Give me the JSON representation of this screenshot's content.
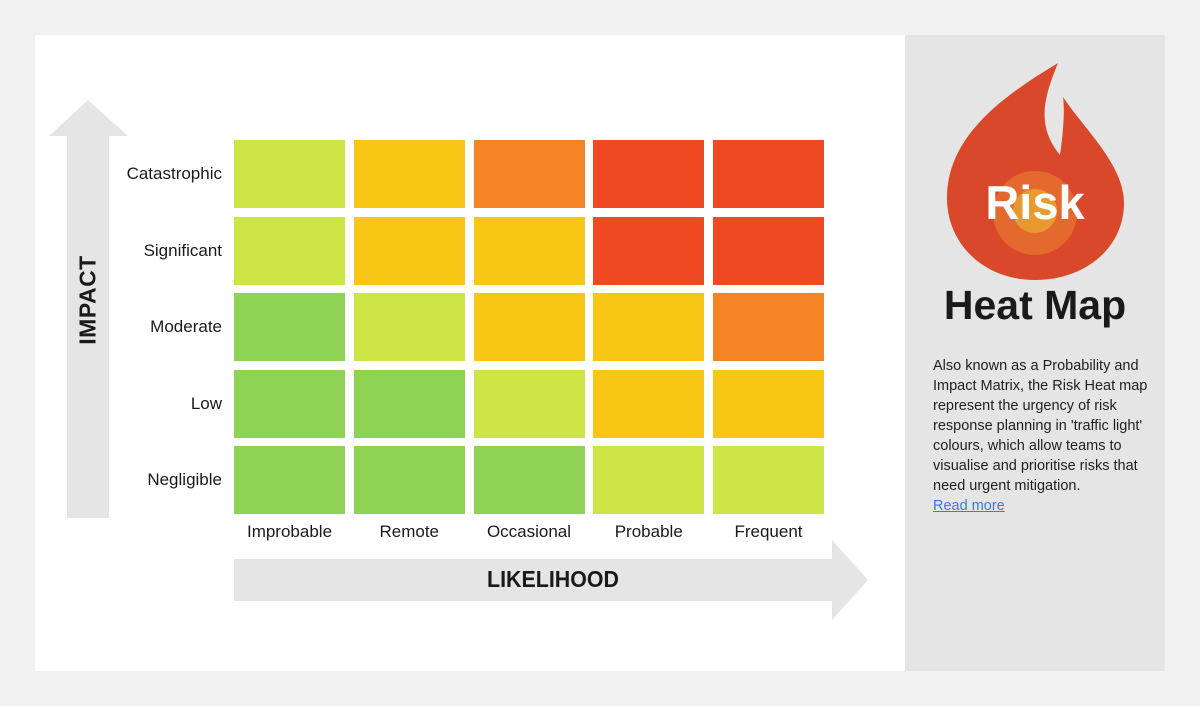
{
  "chart_data": {
    "type": "heatmap",
    "title": "Risk Heat Map",
    "xlabel": "LIKELIHOOD",
    "ylabel": "IMPACT",
    "x_categories": [
      "Improbable",
      "Remote",
      "Occasional",
      "Probable",
      "Frequent"
    ],
    "y_categories": [
      "Catastrophic",
      "Significant",
      "Moderate",
      "Low",
      "Negligible"
    ],
    "levels": {
      "green": "#8ed354",
      "yellow-green": "#cde646",
      "amber": "#f8c614",
      "orange": "#f48425",
      "red": "#f04a25"
    },
    "cells": [
      [
        "yellow-green",
        "amber",
        "orange",
        "red",
        "red"
      ],
      [
        "yellow-green",
        "amber",
        "amber",
        "red",
        "red"
      ],
      [
        "green",
        "yellow-green",
        "amber",
        "amber",
        "orange"
      ],
      [
        "green",
        "green",
        "yellow-green",
        "amber",
        "amber"
      ],
      [
        "green",
        "green",
        "green",
        "yellow-green",
        "yellow-green"
      ]
    ]
  },
  "axes": {
    "impact_label": "IMPACT",
    "likelihood_label": "LIKELIHOOD"
  },
  "rows": [
    "Catastrophic",
    "Significant",
    "Moderate",
    "Low",
    "Negligible"
  ],
  "columns": [
    "Improbable",
    "Remote",
    "Occasional",
    "Probable",
    "Frequent"
  ],
  "side_panel": {
    "logo_word": "Risk",
    "title": "Heat Map",
    "description": "Also known as a Probability and Impact Matrix, the Risk Heat map represent the urgency of risk response planning in 'traffic light' colours, which allow teams to visualise and prioritise risks that need urgent mitigation.",
    "read_more": "Read more",
    "flame_color": "#d9482a",
    "flame_inner_color": "#e4692f",
    "flame_core_color": "#e89a2f"
  },
  "colors": {
    "arrow": "#e5e5e5",
    "page_bg": "#f1f1f1",
    "panel_bg": "#e5e5e5"
  }
}
